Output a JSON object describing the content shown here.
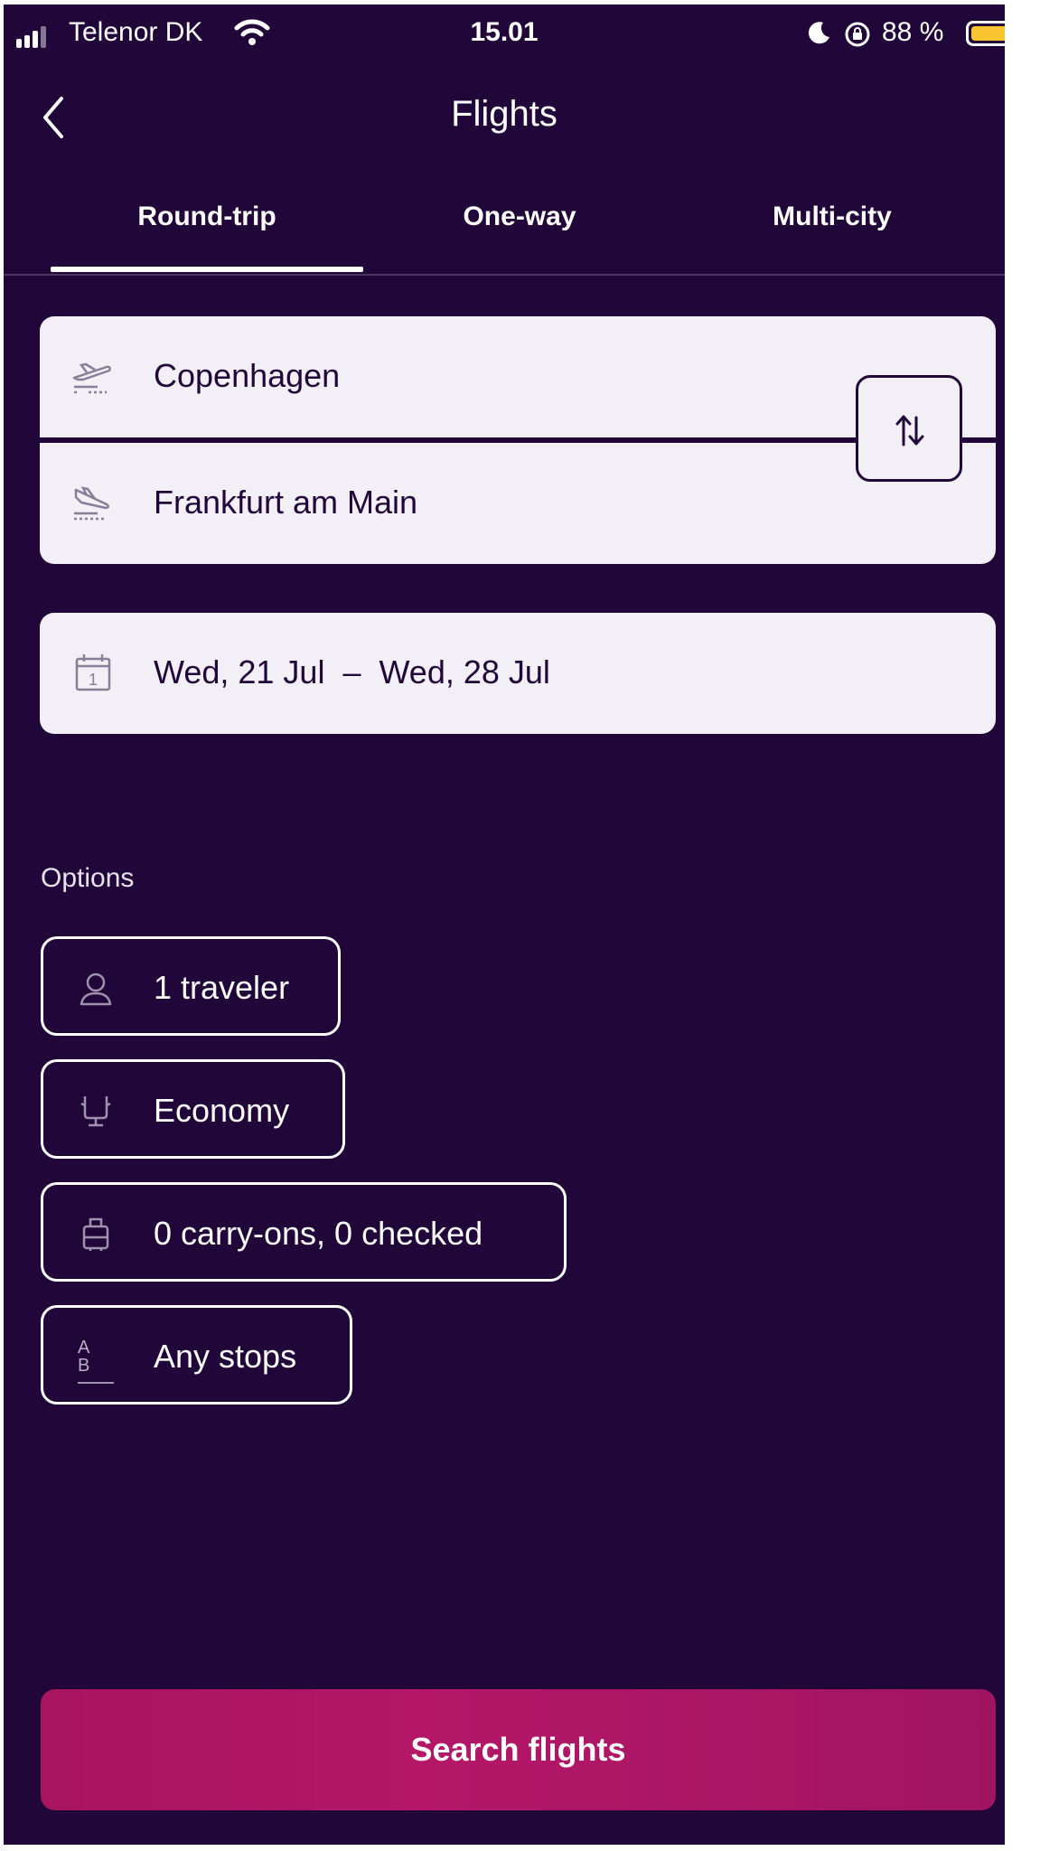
{
  "status_bar": {
    "carrier": "Telenor DK",
    "time": "15.01",
    "battery_percent": "88 %",
    "battery_level": 0.88,
    "icons": [
      "signal-icon",
      "wifi-icon",
      "moon-icon",
      "rotation-lock-icon",
      "battery-icon"
    ]
  },
  "header": {
    "title": "Flights",
    "back_icon": "chevron-left-icon"
  },
  "tabs": [
    {
      "label": "Round-trip",
      "selected": true
    },
    {
      "label": "One-way",
      "selected": false
    },
    {
      "label": "Multi-city",
      "selected": false
    }
  ],
  "route": {
    "origin": "Copenhagen",
    "destination": "Frankfurt am Main",
    "origin_icon": "takeoff-icon",
    "destination_icon": "landing-icon",
    "swap_icon": "swap-vertical-icon"
  },
  "dates": {
    "text": "Wed, 21 Jul  –  Wed, 28 Jul",
    "icon": "calendar-icon",
    "calendar_day": "1"
  },
  "options": {
    "label": "Options",
    "items": [
      {
        "label": "1 traveler",
        "icon": "person-icon"
      },
      {
        "label": "Economy",
        "icon": "seat-icon"
      },
      {
        "label": "0 carry-ons, 0 checked",
        "icon": "luggage-icon"
      },
      {
        "label": "Any stops",
        "icon": "stops-icon",
        "icon_text": "A B"
      }
    ]
  },
  "search_button": {
    "label": "Search flights"
  },
  "colors": {
    "background": "#210639",
    "card": "#f2eff7",
    "accent": "#b51668",
    "battery": "#f8c531"
  }
}
